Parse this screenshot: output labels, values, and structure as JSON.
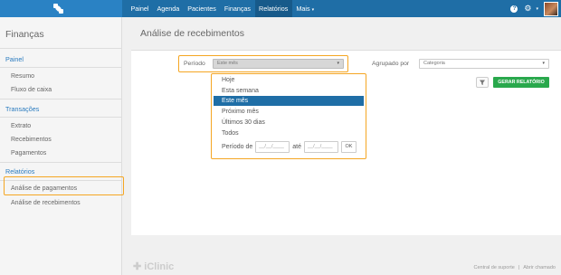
{
  "nav": {
    "items": [
      {
        "label": "Painel"
      },
      {
        "label": "Agenda"
      },
      {
        "label": "Pacientes"
      },
      {
        "label": "Finanças"
      },
      {
        "label": "Relatórios",
        "active": true
      },
      {
        "label": "Mais"
      }
    ],
    "mais_caret": "▾",
    "help_glyph": "?",
    "gear_glyph": "⚙",
    "colors": {
      "bar": "#1f6ea6",
      "active": "#175a8a",
      "logo_bg": "#2a82c4"
    }
  },
  "icons": [
    "logo-icon",
    "help-icon",
    "gear-icon",
    "avatar",
    "filter-icon",
    "chevron-down-icon"
  ],
  "sidebar": {
    "title": "Finanças",
    "sections": [
      {
        "label": "Painel",
        "items": [
          "Resumo",
          "Fluxo de caixa"
        ]
      },
      {
        "label": "Transações",
        "items": [
          "Extrato",
          "Recebimentos",
          "Pagamentos"
        ]
      },
      {
        "label": "Relatórios",
        "items": [
          "Análise de pagamentos",
          "Análise de recebimentos"
        ]
      }
    ]
  },
  "main": {
    "title": "Análise de recebimentos",
    "periodo_label": "Período",
    "periodo_value": "Este mês",
    "agrupado_label": "Agrupado por",
    "agrupado_value": "Categoria",
    "generate_button": "GERAR RELATÓRIO"
  },
  "dropdown": {
    "options": [
      "Hoje",
      "Esta semana",
      "Este mês",
      "Próximo mês",
      "Últimos 30 dias",
      "Todos"
    ],
    "selected_index": 2,
    "range_label": "Período de",
    "range_from_placeholder": "__/__/____",
    "range_to_label": "até",
    "range_to_placeholder": "__/__/____",
    "ok_label": "OK"
  },
  "footer": {
    "brand": "iClinic",
    "support": "Central de suporte",
    "separator": "|",
    "open_ticket": "Abrir chamado"
  },
  "colors": {
    "highlight": "#f5a623",
    "primary": "#1f6ea6",
    "success": "#29a84c"
  }
}
